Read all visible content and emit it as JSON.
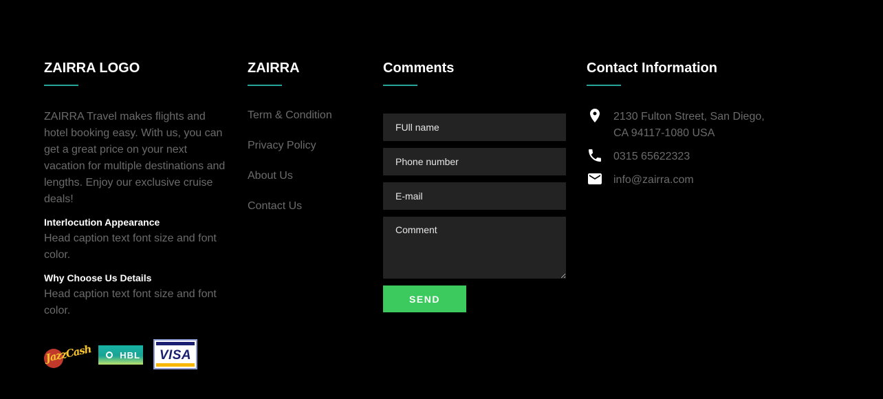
{
  "about": {
    "heading": "ZAIRRA LOGO",
    "text": "ZAIRRA Travel makes flights and hotel booking easy. With us, you can get a great price on your next vacation for multiple destinations and lengths. Enjoy our exclusive cruise deals!",
    "sections": [
      {
        "title": "Interlocution Appearance",
        "text": "Head caption text font size and font color."
      },
      {
        "title": "Why Choose Us Details",
        "text": "Head caption text font size and font color."
      }
    ],
    "payments": [
      {
        "name": "JazzCash",
        "label": "JazzCash",
        "icon": "jazzcash-logo"
      },
      {
        "name": "HBL",
        "label": "HBL",
        "icon": "hbl-logo"
      },
      {
        "name": "VISA",
        "label": "VISA",
        "icon": "visa-logo"
      }
    ]
  },
  "links": {
    "heading": "ZAIRRA",
    "items": [
      "Term & Condition",
      "Privacy Policy",
      "About Us",
      "Contact Us"
    ]
  },
  "comments": {
    "heading": "Comments",
    "fullname_placeholder": "FUll name",
    "phone_placeholder": "Phone number",
    "email_placeholder": "E-mail",
    "comment_placeholder": "Comment",
    "send_label": "SEND"
  },
  "contact": {
    "heading": "Contact Information",
    "address_line1": "2130 Fulton Street, San Diego,",
    "address_line2": "CA 94117-1080 USA",
    "phone": "0315 65622323",
    "email": "info@zairra.com",
    "icons": [
      "location-pin-icon",
      "phone-icon",
      "mail-icon"
    ]
  },
  "colors": {
    "background": "#000000",
    "accent_underline": "#26a69a",
    "send_button": "#3cc95d",
    "field_bg": "#232323",
    "muted_text": "#6b6b6b"
  }
}
